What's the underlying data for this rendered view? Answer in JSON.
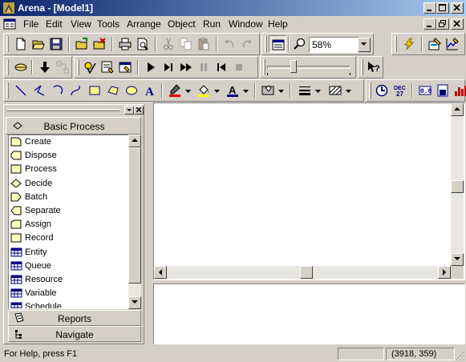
{
  "window": {
    "title": "Arena - [Model1]",
    "app_icon": "arena-app-icon",
    "colors": {
      "titlebar_start": "#0a246a",
      "titlebar_end": "#a6caf0",
      "face": "#d4d0c8"
    }
  },
  "menu": {
    "items": [
      "File",
      "Edit",
      "View",
      "Tools",
      "Arrange",
      "Object",
      "Run",
      "Window",
      "Help"
    ]
  },
  "toolbar": {
    "zoom_value": "58%",
    "animation_speed_percent": 30
  },
  "project_bar": {
    "panel_title": "Basic Process",
    "modules": [
      {
        "label": "Create",
        "icon": "create-module-icon"
      },
      {
        "label": "Dispose",
        "icon": "dispose-module-icon"
      },
      {
        "label": "Process",
        "icon": "process-module-icon"
      },
      {
        "label": "Decide",
        "icon": "decide-module-icon"
      },
      {
        "label": "Batch",
        "icon": "batch-module-icon"
      },
      {
        "label": "Separate",
        "icon": "separate-module-icon"
      },
      {
        "label": "Assign",
        "icon": "assign-module-icon"
      },
      {
        "label": "Record",
        "icon": "record-module-icon"
      },
      {
        "label": "Entity",
        "icon": "entity-data-icon"
      },
      {
        "label": "Queue",
        "icon": "queue-data-icon"
      },
      {
        "label": "Resource",
        "icon": "resource-data-icon"
      },
      {
        "label": "Variable",
        "icon": "variable-data-icon"
      },
      {
        "label": "Schedule",
        "icon": "schedule-data-icon"
      }
    ],
    "reports_label": "Reports",
    "navigate_label": "Navigate"
  },
  "statusbar": {
    "help_text": "For Help, press F1",
    "coordinates": "(3918, 359)"
  }
}
